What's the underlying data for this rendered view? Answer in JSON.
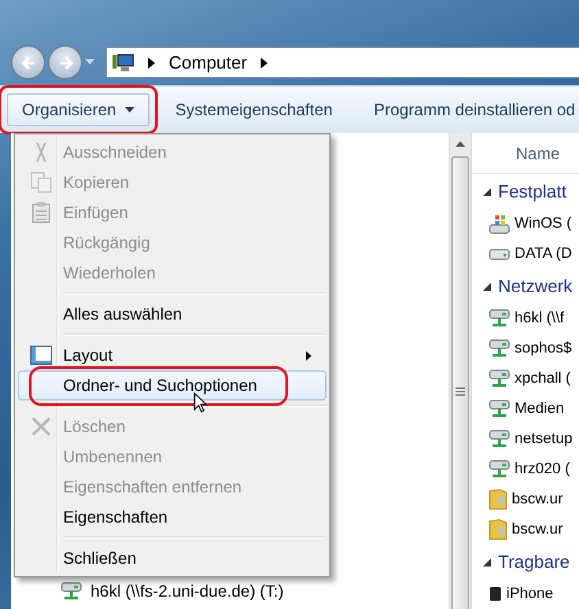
{
  "address_bar": {
    "crumbs": [
      "Computer"
    ]
  },
  "toolbar": {
    "buttons": [
      {
        "label": "Organisieren",
        "dropdown": true,
        "highlighted": true
      },
      {
        "label": "Systemeigenschaften",
        "dropdown": false,
        "highlighted": false
      },
      {
        "label": "Programm deinstallieren od",
        "dropdown": false,
        "highlighted": false
      }
    ]
  },
  "menu": {
    "items": [
      {
        "kind": "item",
        "label": "Ausschneiden",
        "disabled": true,
        "submenu": false,
        "selected": false,
        "highlighted": false
      },
      {
        "kind": "item",
        "label": "Kopieren",
        "disabled": true,
        "submenu": false,
        "selected": false,
        "highlighted": false
      },
      {
        "kind": "item",
        "label": "Einfügen",
        "disabled": true,
        "submenu": false,
        "selected": false,
        "highlighted": false
      },
      {
        "kind": "item",
        "label": "Rückgängig",
        "disabled": true,
        "submenu": false,
        "selected": false,
        "highlighted": false
      },
      {
        "kind": "item",
        "label": "Wiederholen",
        "disabled": true,
        "submenu": false,
        "selected": false,
        "highlighted": false
      },
      {
        "kind": "separator"
      },
      {
        "kind": "item",
        "label": "Alles auswählen",
        "disabled": false,
        "submenu": false,
        "selected": false,
        "highlighted": false
      },
      {
        "kind": "separator"
      },
      {
        "kind": "item",
        "label": "Layout",
        "disabled": false,
        "submenu": true,
        "selected": false,
        "highlighted": false
      },
      {
        "kind": "item",
        "label": "Ordner- und Suchoptionen",
        "disabled": false,
        "submenu": false,
        "selected": true,
        "highlighted": true
      },
      {
        "kind": "separator"
      },
      {
        "kind": "item",
        "label": "Löschen",
        "disabled": true,
        "submenu": false,
        "selected": false,
        "highlighted": false
      },
      {
        "kind": "item",
        "label": "Umbenennen",
        "disabled": true,
        "submenu": false,
        "selected": false,
        "highlighted": false
      },
      {
        "kind": "item",
        "label": "Eigenschaften entfernen",
        "disabled": true,
        "submenu": false,
        "selected": false,
        "highlighted": false
      },
      {
        "kind": "item",
        "label": "Eigenschaften",
        "disabled": false,
        "submenu": false,
        "selected": false,
        "highlighted": false
      },
      {
        "kind": "separator"
      },
      {
        "kind": "item",
        "label": "Schließen",
        "disabled": false,
        "submenu": false,
        "selected": false,
        "highlighted": false
      }
    ]
  },
  "navigation_pane": {
    "items": [
      {
        "label": "h6kl (\\\\fs-2.uni-due.de) (T:)",
        "kind": "network"
      }
    ]
  },
  "content": {
    "column_header": "Name",
    "groups": [
      {
        "label": "Festplatt",
        "expanded": true,
        "items": [
          {
            "label": "WinOS (",
            "kind": "system"
          },
          {
            "label": "DATA (D",
            "kind": "drive"
          }
        ]
      },
      {
        "label": "Netzwerk",
        "expanded": true,
        "items": [
          {
            "label": "h6kl (\\\\f",
            "kind": "network"
          },
          {
            "label": "sophos$",
            "kind": "network"
          },
          {
            "label": "xpchall (",
            "kind": "network"
          },
          {
            "label": "Medien",
            "kind": "network"
          },
          {
            "label": "netsetup",
            "kind": "network"
          },
          {
            "label": "hrz020 (",
            "kind": "network"
          },
          {
            "label": "bscw.ur",
            "kind": "folder"
          },
          {
            "label": "bscw.ur",
            "kind": "folder"
          }
        ]
      },
      {
        "label": "Tragbare",
        "expanded": true,
        "items": [
          {
            "label": "iPhone",
            "kind": "phone"
          }
        ]
      }
    ]
  }
}
